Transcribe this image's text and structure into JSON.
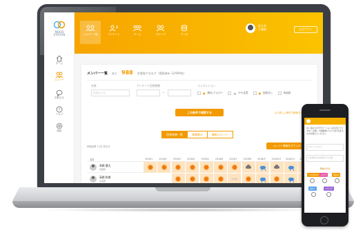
{
  "app": {
    "logo_name": "MOOD\nSTATION",
    "sidebar": [
      {
        "icon": "home-icon",
        "label": "ホーム"
      },
      {
        "icon": "members-icon",
        "label": "メンバー"
      },
      {
        "icon": "chat-icon",
        "label": "お知らせ"
      },
      {
        "icon": "help-icon",
        "label": "ヘルプ"
      },
      {
        "icon": "settings-icon",
        "label": "設定"
      }
    ],
    "topnav": [
      {
        "icon": "members-group-icon",
        "label": "メンバー一覧"
      },
      {
        "icon": "survey-icon",
        "label": "アンケート"
      },
      {
        "icon": "team-icon",
        "label": "チーム"
      },
      {
        "icon": "group-edit-icon",
        "label": "グループ"
      },
      {
        "icon": "database-icon",
        "label": "データ"
      }
    ],
    "user": {
      "name": "佐々木",
      "sub": "人事部"
    },
    "logout_label": "ログアウト"
  },
  "main": {
    "title": "メンバー一覧",
    "count_pre": "あと",
    "count": "988",
    "count_post": "名登録できます（登録済み 12/999名）",
    "filters": {
      "name_label": "名前",
      "name_placeholder": "氏名を入力",
      "date_label": "アンケート回答期間",
      "cond_label": "コンディション"
    },
    "conditions": [
      {
        "icon": "sun-icon",
        "label": "晴れ/フォロー"
      },
      {
        "icon": "cloud-icon",
        "label": "やや注意"
      },
      {
        "icon": "sun-icon",
        "label": "回答なし"
      },
      {
        "icon": "none-icon",
        "label": "未回答"
      }
    ],
    "search_label": "この条件で検索する",
    "detail_link": "より詳しい条件で検索する ›",
    "tabs": [
      "回答結果一覧",
      "詳細表示",
      "最新コメント"
    ],
    "result_note": "検索結果 12名 表示中",
    "download_label": "メンバー情報をダウンロード",
    "grid": {
      "name_header": "名前",
      "months": [
        "2018/1",
        "2018/2",
        "2018/3",
        "2018/4",
        "2018/5",
        "2018/6",
        "2018/7",
        "2018/8",
        "2018/9",
        "2018/10",
        "2018/11",
        "2018/12"
      ],
      "rows": [
        {
          "name": "高橋 健太",
          "dept": "営業部",
          "cells": [
            "sun",
            "sun",
            "sun",
            "sun",
            "sun",
            "sun",
            "sun",
            "cloud",
            "rain",
            "cloud",
            "rain",
            "rain"
          ]
        },
        {
          "name": "高橋 和美",
          "dept": "企画部",
          "cells": [
            "none",
            "none",
            "sun",
            "sun",
            "sun",
            "sun",
            "na",
            "sun",
            "rain",
            "sun",
            "rain",
            "rain"
          ]
        }
      ],
      "na_label": "未回答"
    }
  },
  "phone": {
    "question": "Q1. あなたのモチベーションは今日どうですか？ 仕事・人間関係について当てはまる ものを選んでください。",
    "box1": "入力してください",
    "box2": "その他気持ちを表現できる言葉",
    "section": "現在の気分",
    "tags": [
      {
        "text": "ヤル気MAX",
        "color": "#f29a00"
      },
      {
        "text": "ふつう",
        "color": "#e95aa0"
      },
      {
        "text": "悩み中",
        "color": "#f29a00"
      },
      {
        "text": "疲れた",
        "color": "#5aa0e9"
      },
      {
        "text": "イマイチ",
        "color": "#9b6ad8"
      }
    ]
  }
}
